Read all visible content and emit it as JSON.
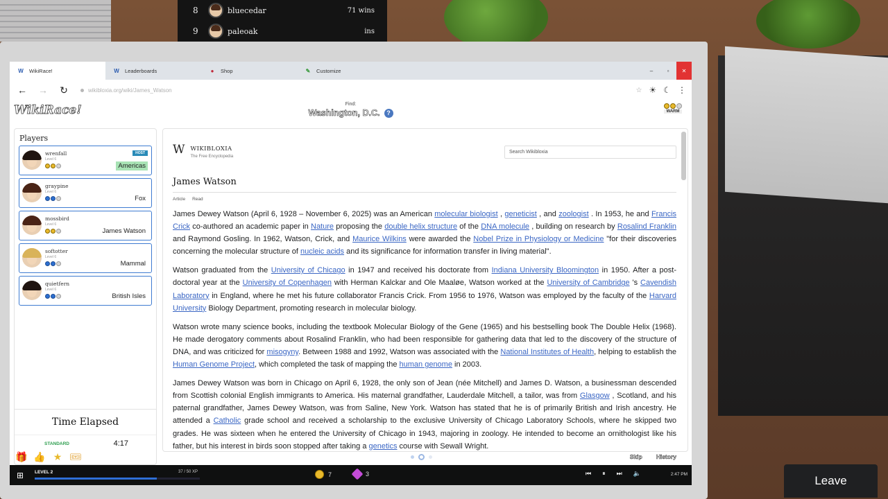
{
  "leaderboard_overlay": [
    {
      "rank": "8",
      "name": "bluecedar",
      "wins": "71 wins"
    },
    {
      "rank": "9",
      "name": "paleoak",
      "wins": "ins"
    }
  ],
  "leave_button": "Leave",
  "tabs": [
    {
      "label": "WikiRace!",
      "icon": "wiki-icon"
    },
    {
      "label": "Leaderboards",
      "icon": "wiki-icon"
    },
    {
      "label": "Shop",
      "icon": "shop-icon"
    },
    {
      "label": "Customize",
      "icon": "palette-icon"
    }
  ],
  "window_controls": {
    "minimize": "–",
    "maximize": "▫",
    "close": "✕"
  },
  "address": {
    "url": "wikibloxia.org/wiki/James_Watson"
  },
  "game": {
    "logo": "WikiRace!",
    "find_label": "Find:",
    "target": "Washington, D.C.",
    "rank_label": "WARM"
  },
  "players": {
    "heading": "Players",
    "list": [
      {
        "name": "wrenfall",
        "level": "Level 6",
        "page": "Americas",
        "host": "HOST",
        "hair": "#1f1410",
        "coin_color": "gold"
      },
      {
        "name": "graypine",
        "level": "Level 6",
        "page": "Fox",
        "host": "",
        "hair": "#4a2416",
        "coin_color": "blue"
      },
      {
        "name": "mossbird",
        "level": "Level 6",
        "page": "James Watson",
        "host": "",
        "hair": "#4a2416",
        "coin_color": "gold"
      },
      {
        "name": "softotter",
        "level": "Level 6",
        "page": "Mammal",
        "host": "",
        "hair": "#d9b35a",
        "coin_color": "blue"
      },
      {
        "name": "quietfern",
        "level": "Level 6",
        "page": "British Isles",
        "host": "",
        "hair": "#1f1410",
        "coin_color": "blue"
      }
    ]
  },
  "timer": {
    "label": "Time Elapsed",
    "mode": "STANDARD",
    "value": "4:17"
  },
  "article": {
    "site_name": "WIKIBLOXIA",
    "site_sub": "The Free Encyclopedia",
    "search_placeholder": "Search Wikibloxia",
    "title": "James Watson",
    "tab_article": "Article",
    "tab_read": "Read"
  },
  "footer": {
    "skip": "Skip",
    "history": "History"
  },
  "taskbar": {
    "level": "LEVEL 2",
    "xp": "37 / 50 XP",
    "xp_fraction": 0.74,
    "coins": "7",
    "gems": "3",
    "clock": "2:47 PM"
  },
  "colors": {
    "link": "#3a66c4",
    "accent": "#3e7bd1",
    "highlight": "#a8e3b5"
  }
}
